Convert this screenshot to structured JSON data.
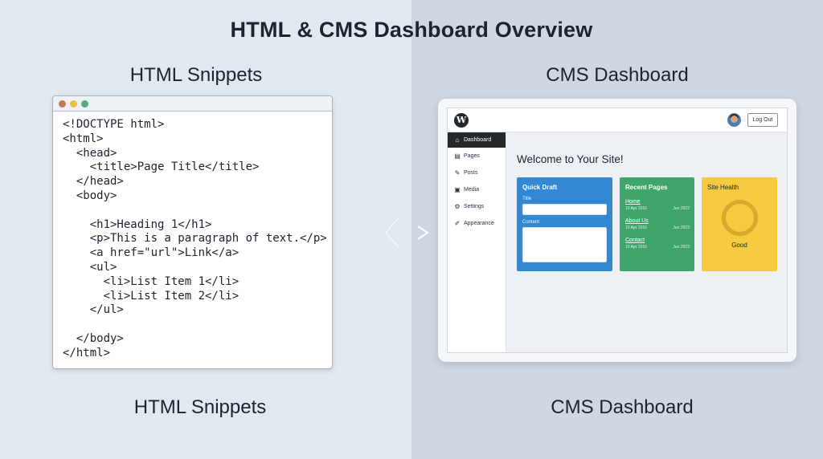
{
  "title": "HTML & CMS Dashboard Overview",
  "left_label_top": "HTML Snippets",
  "right_label_top": "CMS Dashboard",
  "left_label_bottom": "HTML Snippets",
  "right_label_bottom": "CMS Dashboard",
  "code_lines": [
    "<!DOCTYPE html>",
    "<html>",
    "  <head>",
    "    <title>Page Title</title>",
    "  </head>",
    "  <body>",
    "",
    "    <h1>Heading 1</h1>",
    "    <p>This is a paragraph of text.</p>",
    "    <a href=\"url\">Link</a>",
    "    <ul>",
    "      <li>List Item 1</li>",
    "      <li>List Item 2</li>",
    "    </ul>",
    "",
    "  </body>",
    "</html>"
  ],
  "cms": {
    "logo_letter": "W",
    "logout_label": "Log Out",
    "sidebar": [
      {
        "label": "Dashboard",
        "icon": "home-icon",
        "glyph": "⌂",
        "active": true
      },
      {
        "label": "Pages",
        "icon": "pages-icon",
        "glyph": "▤",
        "active": false
      },
      {
        "label": "Posts",
        "icon": "pin-icon",
        "glyph": "✎",
        "active": false
      },
      {
        "label": "Media",
        "icon": "media-icon",
        "glyph": "▣",
        "active": false
      },
      {
        "label": "Settings",
        "icon": "gear-icon",
        "glyph": "⚙",
        "active": false
      },
      {
        "label": "Appearance",
        "icon": "brush-icon",
        "glyph": "✐",
        "active": false
      }
    ],
    "welcome": "Welcome to Your Site!",
    "quick_draft": {
      "title": "Quick Draft",
      "title_label": "Title",
      "content_label": "Content"
    },
    "recent_pages": {
      "title": "Recent Pages",
      "items": [
        {
          "name": "Home",
          "meta": "10 Apr 2016",
          "date": "Jan 2022"
        },
        {
          "name": "About Us",
          "meta": "10 Apr 2016",
          "date": "Jan 2023"
        },
        {
          "name": "Contact",
          "meta": "10 Apr 2016",
          "date": "Jan 2023"
        }
      ]
    },
    "site_health": {
      "title": "Site Health",
      "status": "Good"
    },
    "colors": {
      "draft": "#3388d4",
      "pages": "#3fa56b",
      "health": "#f5ca3e",
      "sidebar_active": "#23282d"
    }
  }
}
